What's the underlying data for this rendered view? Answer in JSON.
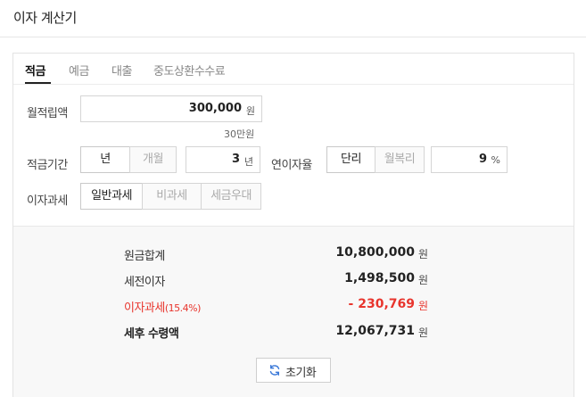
{
  "header": {
    "title": "이자 계산기"
  },
  "tabs": [
    {
      "label": "적금",
      "active": true
    },
    {
      "label": "예금",
      "active": false
    },
    {
      "label": "대출",
      "active": false
    },
    {
      "label": "중도상환수수료",
      "active": false
    }
  ],
  "form": {
    "monthly_deposit": {
      "label": "월적립액",
      "value": "300,000",
      "unit": "원",
      "hint": "30만원"
    },
    "period": {
      "label": "적금기간",
      "options": [
        {
          "label": "년",
          "active": true
        },
        {
          "label": "개월",
          "active": false
        }
      ],
      "value": "3",
      "unit": "년"
    },
    "interest_rate": {
      "label": "연이자율",
      "options": [
        {
          "label": "단리",
          "active": true
        },
        {
          "label": "월복리",
          "active": false
        }
      ],
      "value": "9",
      "unit": "%"
    },
    "tax": {
      "label": "이자과세",
      "options": [
        {
          "label": "일반과세",
          "active": true
        },
        {
          "label": "비과세",
          "active": false
        },
        {
          "label": "세금우대",
          "active": false
        }
      ]
    }
  },
  "result": {
    "principal": {
      "label": "원금합계",
      "value": "10,800,000",
      "unit": "원"
    },
    "pretax_interest": {
      "label": "세전이자",
      "value": "1,498,500",
      "unit": "원"
    },
    "tax": {
      "label": "이자과세",
      "rate": "(15.4%)",
      "value": "- 230,769",
      "unit": "원"
    },
    "after_tax": {
      "label": "세후 수령액",
      "value": "12,067,731",
      "unit": "원"
    },
    "reset_label": "초기화"
  },
  "colors": {
    "accent_red": "#e8352d",
    "refresh_icon_blue": "#3a78d8"
  }
}
